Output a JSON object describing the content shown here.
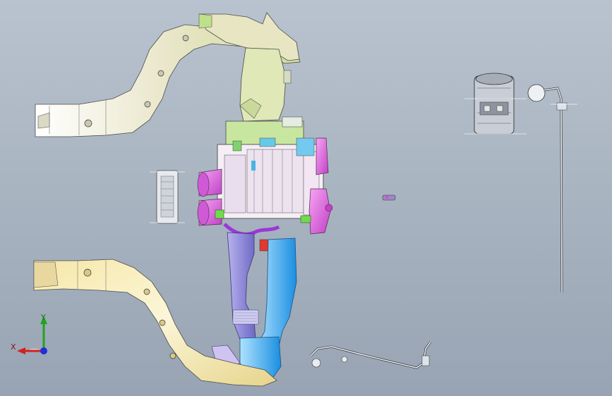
{
  "viewport": {
    "background_top": "#b9c3cf",
    "background_bottom": "#98a4b3"
  },
  "triad": {
    "x_label": "X",
    "y_label": "Y",
    "x_color": "#d42020",
    "y_color": "#1fa41f",
    "z_color": "#1e2fd6"
  },
  "colors": {
    "upper_duct": "#e9e6c9",
    "lower_duct": "#f0e6b0",
    "hvac_housing": "#f4eef5",
    "blower": "#d86adc",
    "tube_left": "#e26ee0",
    "lower_outlet_blue": "#2fa9f0",
    "lower_outlet_purple": "#8e86d8",
    "green_parts": "#9fdc73",
    "compressor_grey": "#c8cdd6",
    "lines_grey": "#e8ecf0"
  }
}
